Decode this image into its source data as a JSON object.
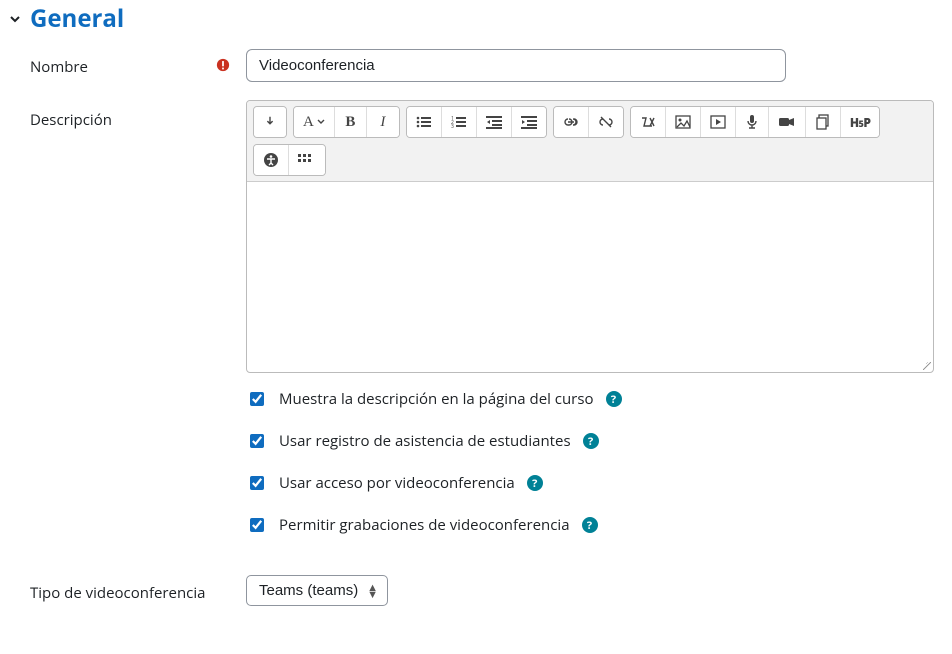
{
  "section_title": "General",
  "fields": {
    "name": {
      "label": "Nombre",
      "value": "Videoconferencia"
    },
    "description": {
      "label": "Descripción",
      "value": ""
    },
    "vc_type": {
      "label": "Tipo de videoconferencia",
      "selected": "Teams (teams)",
      "options": [
        "Teams (teams)"
      ]
    }
  },
  "checkboxes": {
    "show_desc": {
      "label": "Muestra la descripción en la página del curso",
      "checked": true
    },
    "attendance": {
      "label": "Usar registro de asistencia de estudiantes",
      "checked": true
    },
    "vc_access": {
      "label": "Usar acceso por videoconferencia",
      "checked": true
    },
    "recordings": {
      "label": "Permitir grabaciones de videoconferencia",
      "checked": true
    }
  },
  "toolbar": {
    "groups": [
      [
        "expand"
      ],
      [
        "styles",
        "bold",
        "italic"
      ],
      [
        "ul",
        "ol",
        "outdent",
        "indent"
      ],
      [
        "link",
        "unlink"
      ],
      [
        "equation",
        "image",
        "media",
        "mic",
        "video",
        "files",
        "h5p"
      ],
      [
        "a11y",
        "screenreader"
      ]
    ],
    "labels": {
      "expand": "Show more buttons",
      "styles": "Paragraph styles",
      "bold": "Bold",
      "italic": "Italic",
      "ul": "Unordered list",
      "ol": "Ordered list",
      "outdent": "Outdent",
      "indent": "Indent",
      "link": "Link",
      "unlink": "Unlink",
      "equation": "Equation editor",
      "image": "Insert image",
      "media": "Insert media",
      "mic": "Record audio",
      "video": "Record video",
      "files": "Manage files",
      "h5p": "H5P",
      "a11y": "Accessibility checker",
      "screenreader": "Screenreader helper"
    }
  }
}
